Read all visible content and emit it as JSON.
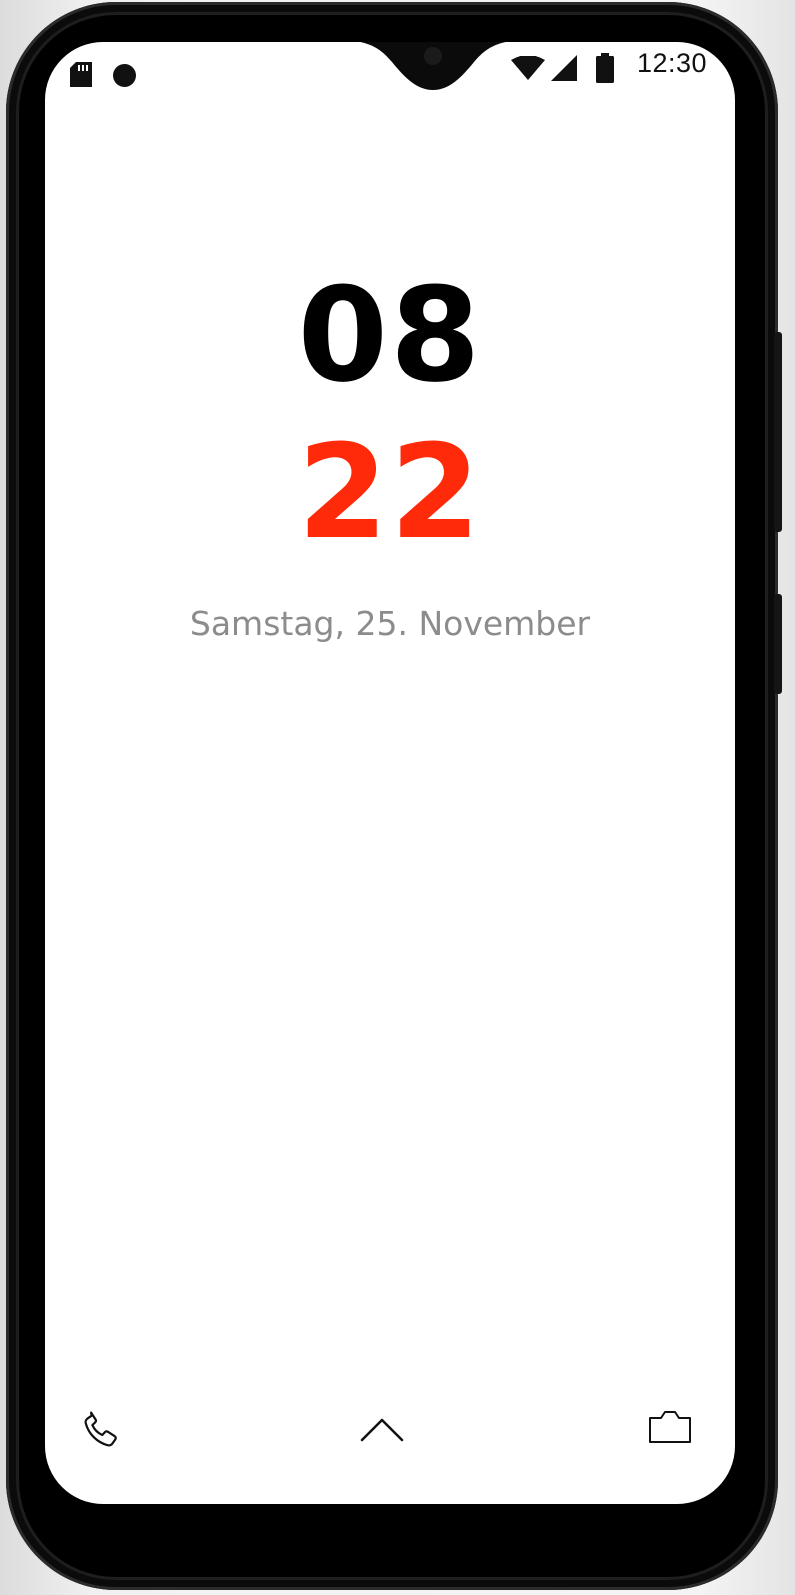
{
  "status_bar": {
    "time": "12:30",
    "icons": [
      "sd-card-icon",
      "notification-dot-icon",
      "wifi-icon",
      "cell-signal-icon",
      "battery-icon"
    ]
  },
  "lockscreen": {
    "hours": "08",
    "minutes": "22",
    "date": "Samstag, 25. November"
  },
  "bottom_actions": {
    "left": "phone-icon",
    "center": "chevron-up-icon",
    "right": "camera-icon"
  },
  "colors": {
    "minutes": "#ff2a0a",
    "hours": "#000000",
    "date": "#8c8c8c",
    "screen": "#ffffff"
  }
}
